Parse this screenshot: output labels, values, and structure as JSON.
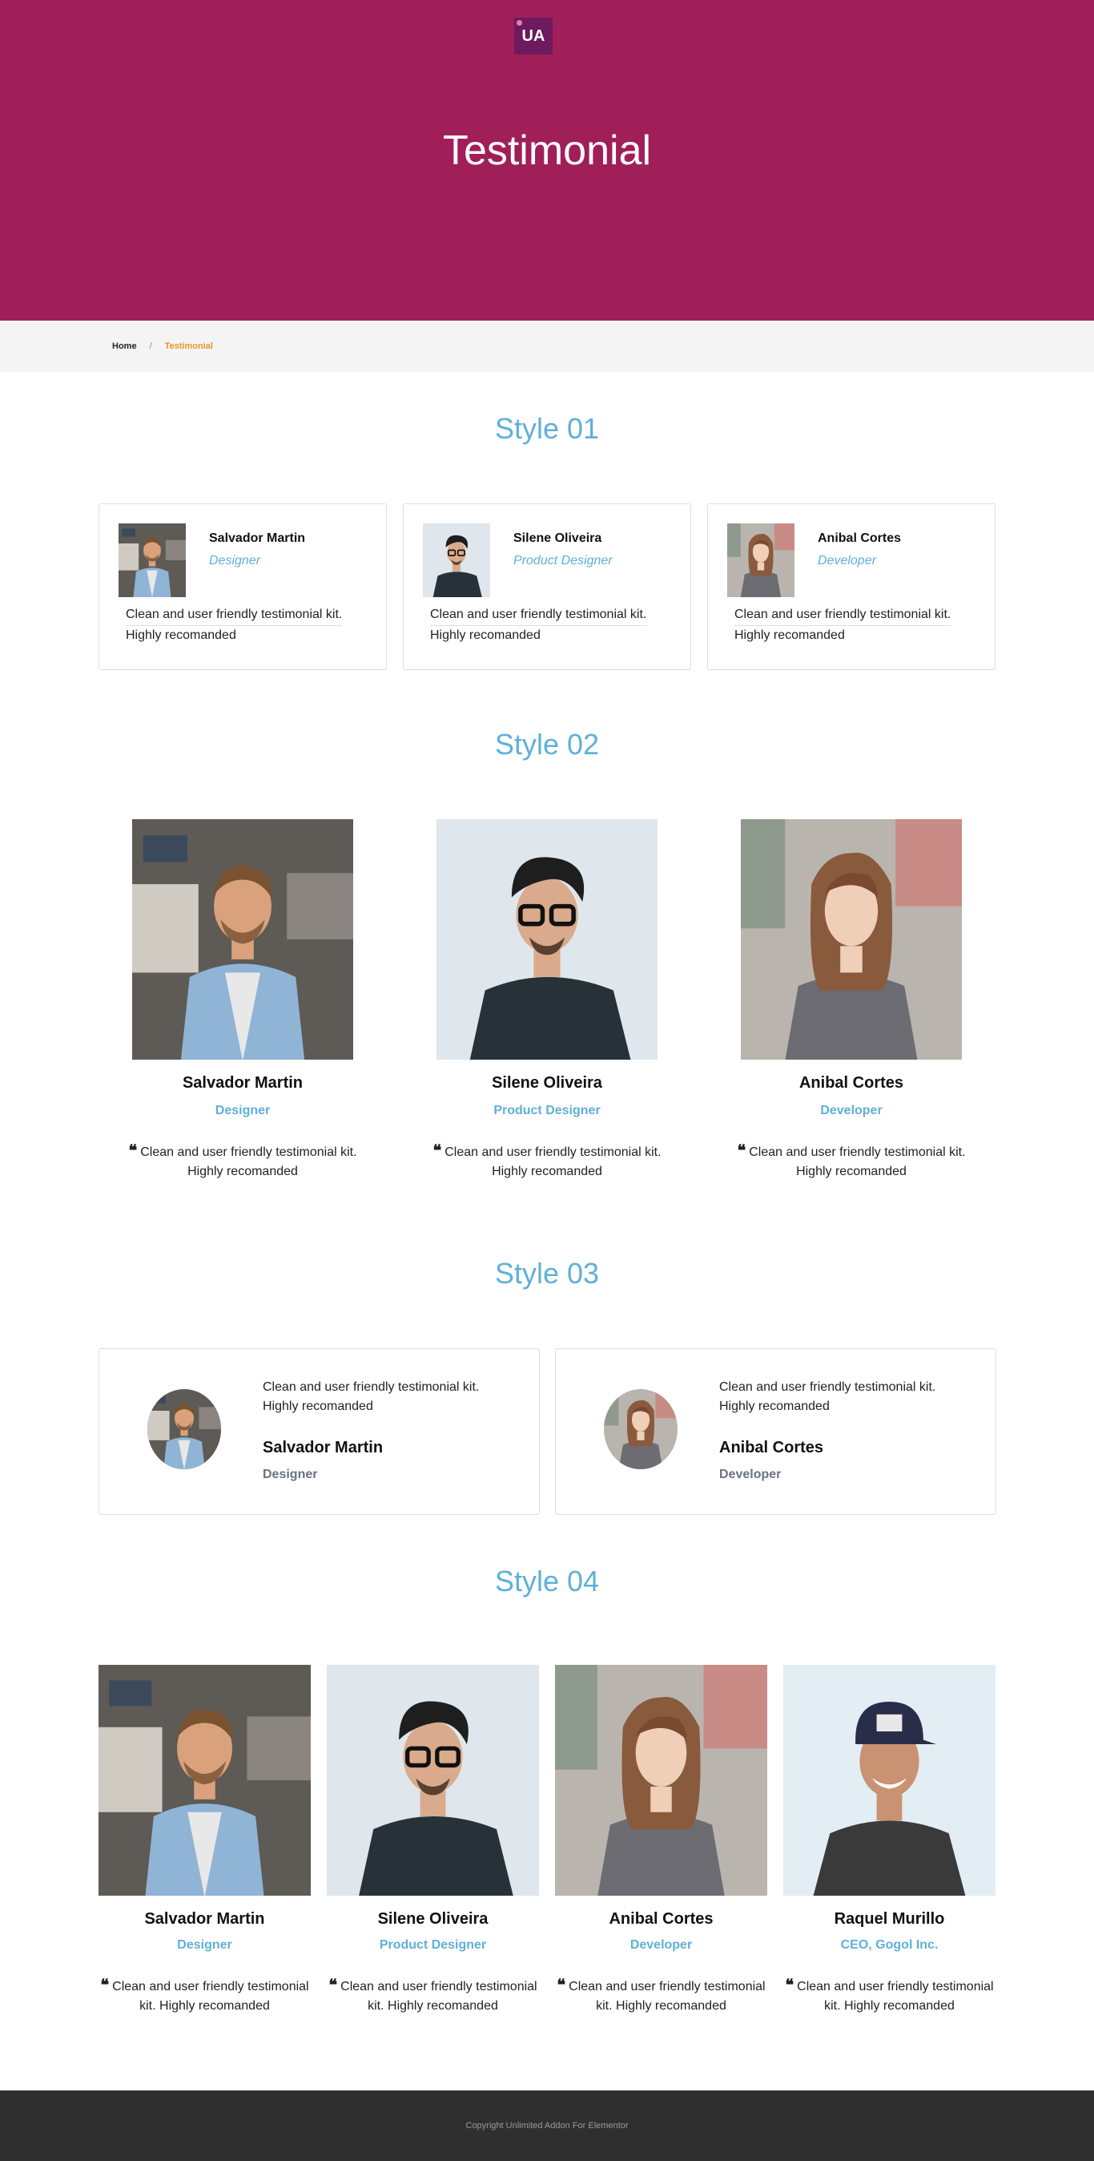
{
  "header": {
    "logo": "UA",
    "title": "Testimonial"
  },
  "breadcrumb": {
    "home": "Home",
    "separator": "/",
    "current": "Testimonial"
  },
  "sections": {
    "style01": "Style 01",
    "style02": "Style 02",
    "style03": "Style 03",
    "style04": "Style 04"
  },
  "testimonial_text": "Clean and user friendly testimonial kit. Highly recomanded",
  "testimonial_line1": "Clean and user friendly testimonial kit.",
  "testimonial_line2": "Highly recomanded",
  "people": [
    {
      "name": "Salvador Martin",
      "role": "Designer"
    },
    {
      "name": "Silene Oliveira",
      "role": "Product Designer"
    },
    {
      "name": "Anibal Cortes",
      "role": "Developer"
    },
    {
      "name": "Raquel Murillo",
      "role": "CEO, Gogol Inc."
    }
  ],
  "footer": {
    "copyright": "Copyright Unlimited Addon For Elementor"
  },
  "colors": {
    "hero": "#a01f58",
    "accent": "#5fb0d8",
    "breadcrumb_active": "#e8962a",
    "footer": "#2f2f2f"
  }
}
